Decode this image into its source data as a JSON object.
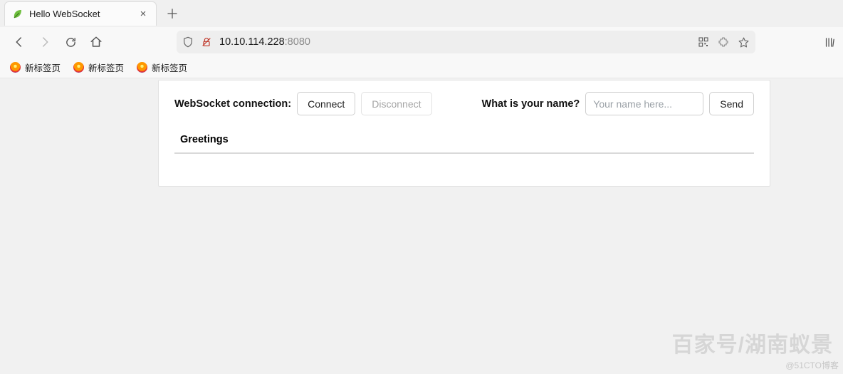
{
  "tab": {
    "title": "Hello WebSocket"
  },
  "address": {
    "host": "10.10.114.228",
    "port": ":8080"
  },
  "bookmarks": [
    "新标签页",
    "新标签页",
    "新标签页"
  ],
  "page": {
    "connection_label": "WebSocket connection:",
    "connect_label": "Connect",
    "disconnect_label": "Disconnect",
    "name_prompt": "What is your name?",
    "name_placeholder": "Your name here...",
    "send_label": "Send",
    "table_header": "Greetings"
  },
  "watermark": {
    "main": "百家号/湖南蚁景",
    "sub": "@51CTO博客"
  }
}
